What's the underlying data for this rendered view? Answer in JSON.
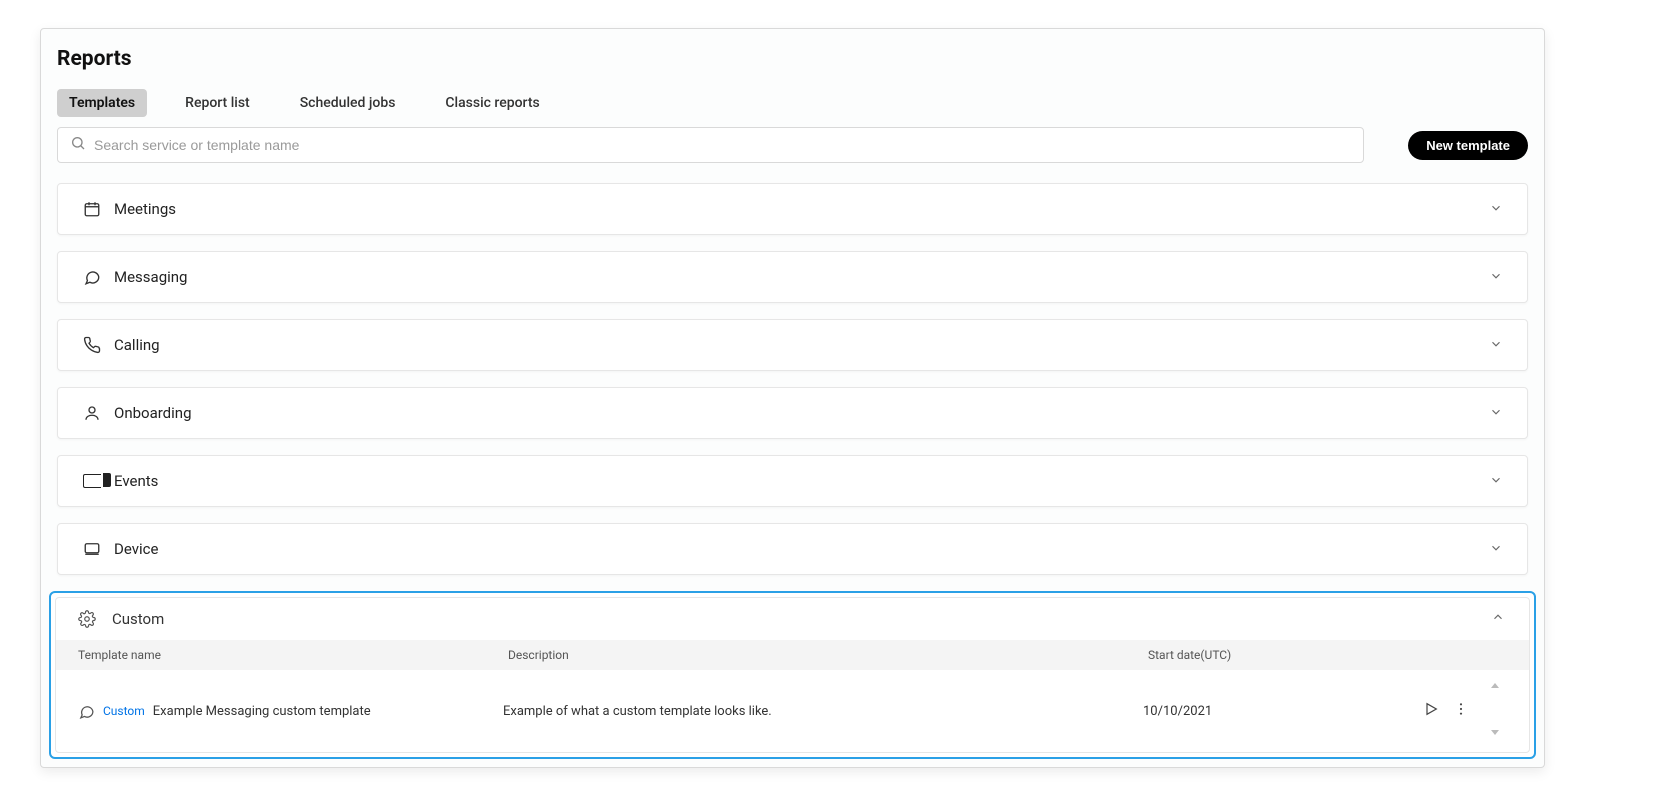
{
  "page": {
    "title": "Reports"
  },
  "tabs": [
    {
      "id": "templates",
      "label": "Templates",
      "active": true
    },
    {
      "id": "reportlist",
      "label": "Report list",
      "active": false
    },
    {
      "id": "scheduled",
      "label": "Scheduled jobs",
      "active": false
    },
    {
      "id": "classic",
      "label": "Classic reports",
      "active": false
    }
  ],
  "search": {
    "placeholder": "Search service or template name"
  },
  "newTemplateLabel": "New template",
  "sections": [
    {
      "key": "meetings",
      "label": "Meetings",
      "icon": "calendar"
    },
    {
      "key": "messaging",
      "label": "Messaging",
      "icon": "chat"
    },
    {
      "key": "calling",
      "label": "Calling",
      "icon": "phone"
    },
    {
      "key": "onboarding",
      "label": "Onboarding",
      "icon": "person"
    },
    {
      "key": "events",
      "label": "Events",
      "icon": "ticket"
    },
    {
      "key": "device",
      "label": "Device",
      "icon": "device"
    }
  ],
  "custom": {
    "label": "Custom",
    "columns": {
      "name": "Template name",
      "desc": "Description",
      "date": "Start date(UTC)"
    },
    "rows": [
      {
        "badge": "Custom",
        "name": "Example Messaging custom template",
        "desc": "Example of what a custom template looks like.",
        "date": "10/10/2021"
      }
    ]
  }
}
